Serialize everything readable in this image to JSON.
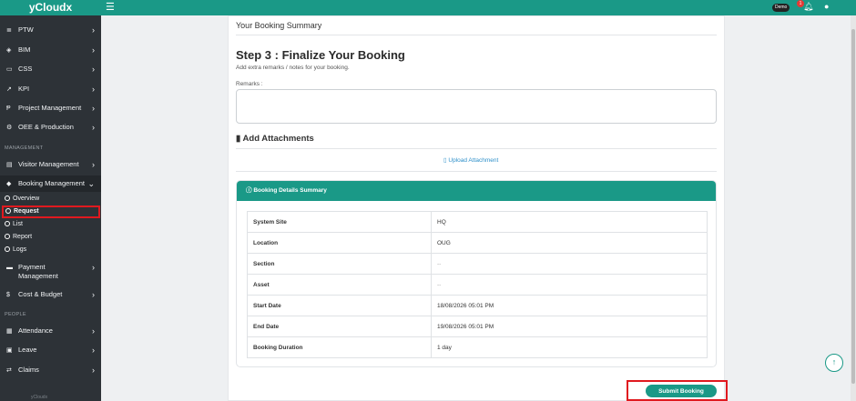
{
  "app": {
    "brand": "yCloudx"
  },
  "topbar": {
    "badge": "Demo",
    "notifications": "1",
    "menu_icon": "hamburger-icon",
    "bell_icon": "bell-icon",
    "user_icon": "user-icon"
  },
  "sidebar": {
    "items_top": [
      {
        "label": "PTW",
        "icon": "≣"
      },
      {
        "label": "BIM",
        "icon": "◈"
      },
      {
        "label": "CSS",
        "icon": "▭"
      },
      {
        "label": "KPI",
        "icon": "↗"
      },
      {
        "label": "Project Management",
        "icon": "Ᵽ"
      },
      {
        "label": "OEE & Production",
        "icon": "⚙"
      }
    ],
    "section_management": "MANAGEMENT",
    "visitor": "Visitor Management",
    "booking": "Booking Management",
    "booking_sub": [
      "Overview",
      "Request",
      "List",
      "Report",
      "Logs"
    ],
    "payment_line1": "Payment",
    "payment_line2": "Management",
    "cost": "Cost & Budget",
    "section_people": "PEOPLE",
    "attendance": "Attendance",
    "leave": "Leave",
    "claims": "Claims",
    "footer_brand": "yCloudx"
  },
  "main": {
    "header": "Your Booking Summary",
    "step_title": "Step 3 : Finalize Your Booking",
    "step_subtitle": "Add extra remarks / notes for your booking.",
    "remarks_label": "Remarks :",
    "remarks_value": "",
    "attachments_title": "Add Attachments",
    "upload_label": "Upload Attachment",
    "summary_title": "Booking Details Summary",
    "details": [
      {
        "key": "System Site",
        "value": "HQ"
      },
      {
        "key": "Location",
        "value": "OUG"
      },
      {
        "key": "Section",
        "value": "--"
      },
      {
        "key": "Asset",
        "value": "--"
      },
      {
        "key": "Start Date",
        "value": "18/08/2026 05:01 PM"
      },
      {
        "key": "End Date",
        "value": "19/08/2026 05:01 PM"
      },
      {
        "key": "Booking Duration",
        "value": "1 day"
      }
    ],
    "submit_label": "Submit Booking"
  },
  "colors": {
    "accent": "#1a9987",
    "sidebar": "#2d3237",
    "highlight": "#e0191f"
  }
}
